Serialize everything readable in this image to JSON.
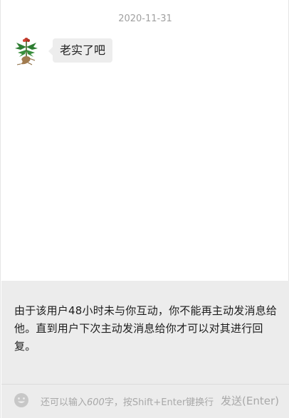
{
  "chat": {
    "timestamp": "2020-11-31",
    "messages": [
      {
        "avatar_icon": "ginseng-avatar-icon",
        "text": "老实了吧"
      }
    ]
  },
  "notice": {
    "text": "由于该用户48小时未与你互动，你不能再主动发消息给他。直到用户下次主动发消息给你才可以对其进行回复。"
  },
  "input_bar": {
    "emoji_icon": "emoji-icon",
    "hint_prefix": "还可以输入",
    "hint_count": "600",
    "hint_suffix": "字，按Shift+Enter键换行",
    "send_label": "发送(Enter)"
  },
  "colors": {
    "bubble": "#ededed",
    "panel": "#ececec",
    "muted_text": "#a8a8a8"
  }
}
